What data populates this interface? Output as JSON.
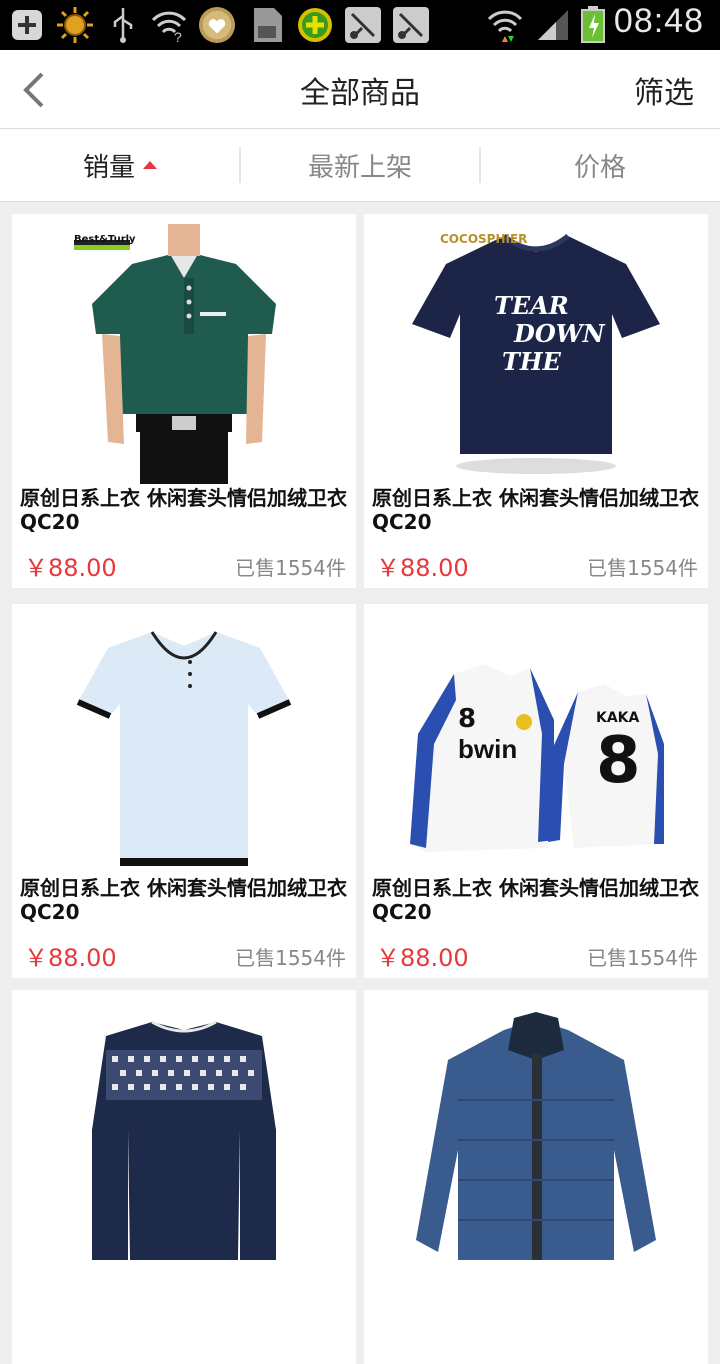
{
  "status_bar": {
    "time": "08:48",
    "icons": [
      "add-icon",
      "sun-icon",
      "usb-icon",
      "wifi-question-icon",
      "heart-icon",
      "sd-card-icon",
      "plus-circle-icon",
      "cut-icon",
      "cut-icon",
      "wifi-icon",
      "signal-icon",
      "battery-icon"
    ]
  },
  "header": {
    "title": "全部商品",
    "filter_label": "筛选"
  },
  "sort": {
    "tabs": [
      {
        "label": "销量",
        "active": true
      },
      {
        "label": "最新上架",
        "active": false
      },
      {
        "label": "价格",
        "active": false
      }
    ]
  },
  "products": [
    {
      "name": "原创日系上衣 休闲套头情侣加绒卫衣QC20",
      "price": "￥88.00",
      "sold": "已售1554件",
      "brand": "Best&Turly",
      "image": "green-polo-shirt"
    },
    {
      "name": "原创日系上衣 休闲套头情侣加绒卫衣QC20",
      "price": "￥88.00",
      "sold": "已售1554件",
      "brand": "COCOSPHIER",
      "image": "navy-tshirt"
    },
    {
      "name": "原创日系上衣 休闲套头情侣加绒卫衣QC20",
      "price": "￥88.00",
      "sold": "已售1554件",
      "image": "light-blue-tshirt"
    },
    {
      "name": "原创日系上衣 休闲套头情侣加绒卫衣QC20",
      "price": "￥88.00",
      "sold": "已售1554件",
      "image": "football-jersey"
    },
    {
      "name": "",
      "price": "",
      "sold": "",
      "image": "patterned-sweater"
    },
    {
      "name": "",
      "price": "",
      "sold": "",
      "image": "blue-jacket"
    }
  ],
  "image_text": {
    "tshirt_print": [
      "TEAR",
      "DOWN",
      "THE"
    ],
    "jersey_number": "8",
    "jersey_sponsor": "bwin",
    "jersey_name": "KAKA"
  },
  "colors": {
    "accent": "#e8383d",
    "background": "#efefef"
  }
}
